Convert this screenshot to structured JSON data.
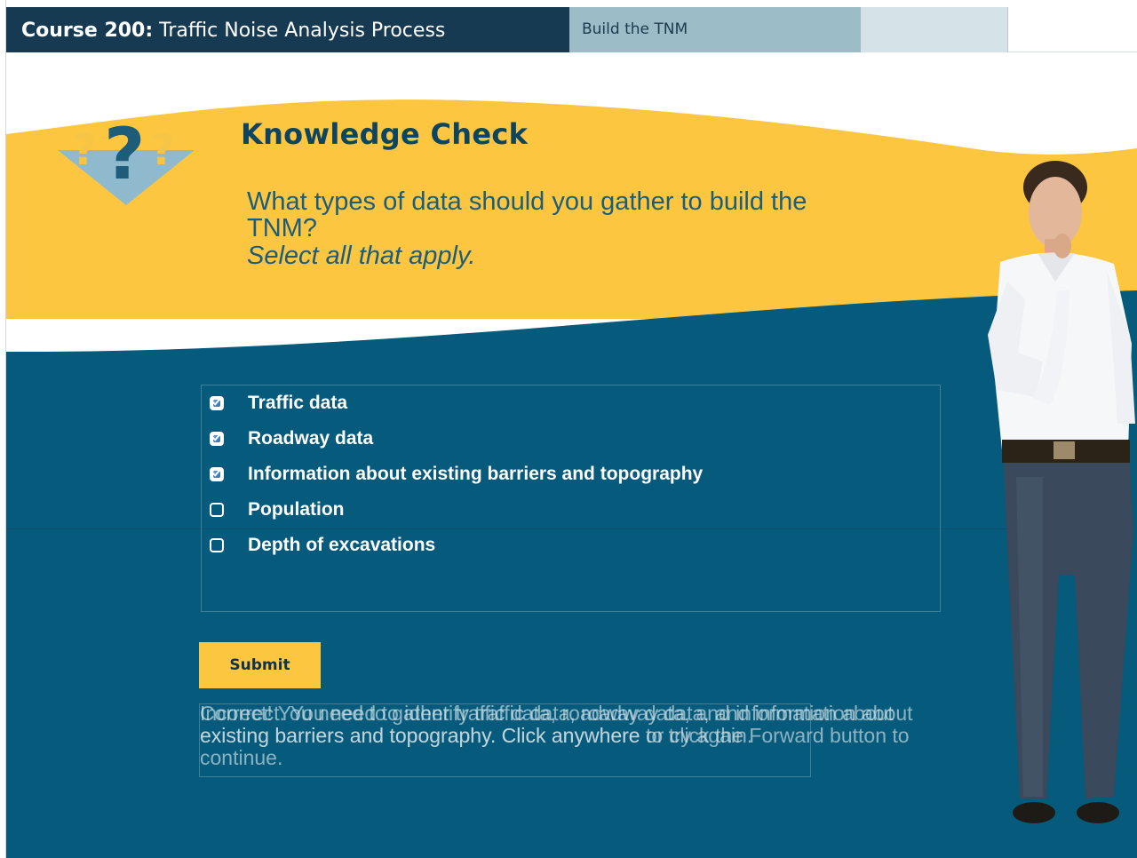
{
  "header": {
    "course_bold": "Course 200:",
    "course_rest": " Traffic Noise Analysis Process",
    "module_tab": "Build the TNM"
  },
  "slide": {
    "title": "Knowledge Check",
    "question": "What types of data should you gather to build the TNM?",
    "instruction": "Select all that apply.",
    "options": [
      {
        "label": "Traffic data",
        "checked": true
      },
      {
        "label": "Roadway data",
        "checked": true
      },
      {
        "label": "Information about existing barriers and topography",
        "checked": true
      },
      {
        "label": "Population",
        "checked": false
      },
      {
        "label": "Depth of excavations",
        "checked": false
      }
    ],
    "submit_label": "Submit",
    "feedback_correct": "Correct! You need to gather traffic data, roadway data, and information about existing barriers and topography. Click anywhere or click the Forward button to continue.",
    "feedback_incorrect": "Incorrect. You need to identify traffic data, roadway data, and information about existing barriers and topography. Click anywhere to try again."
  },
  "colors": {
    "navy": "#163a52",
    "teal": "#065a7b",
    "yellow": "#fcc640",
    "light_tab": "#9cbcc8"
  }
}
